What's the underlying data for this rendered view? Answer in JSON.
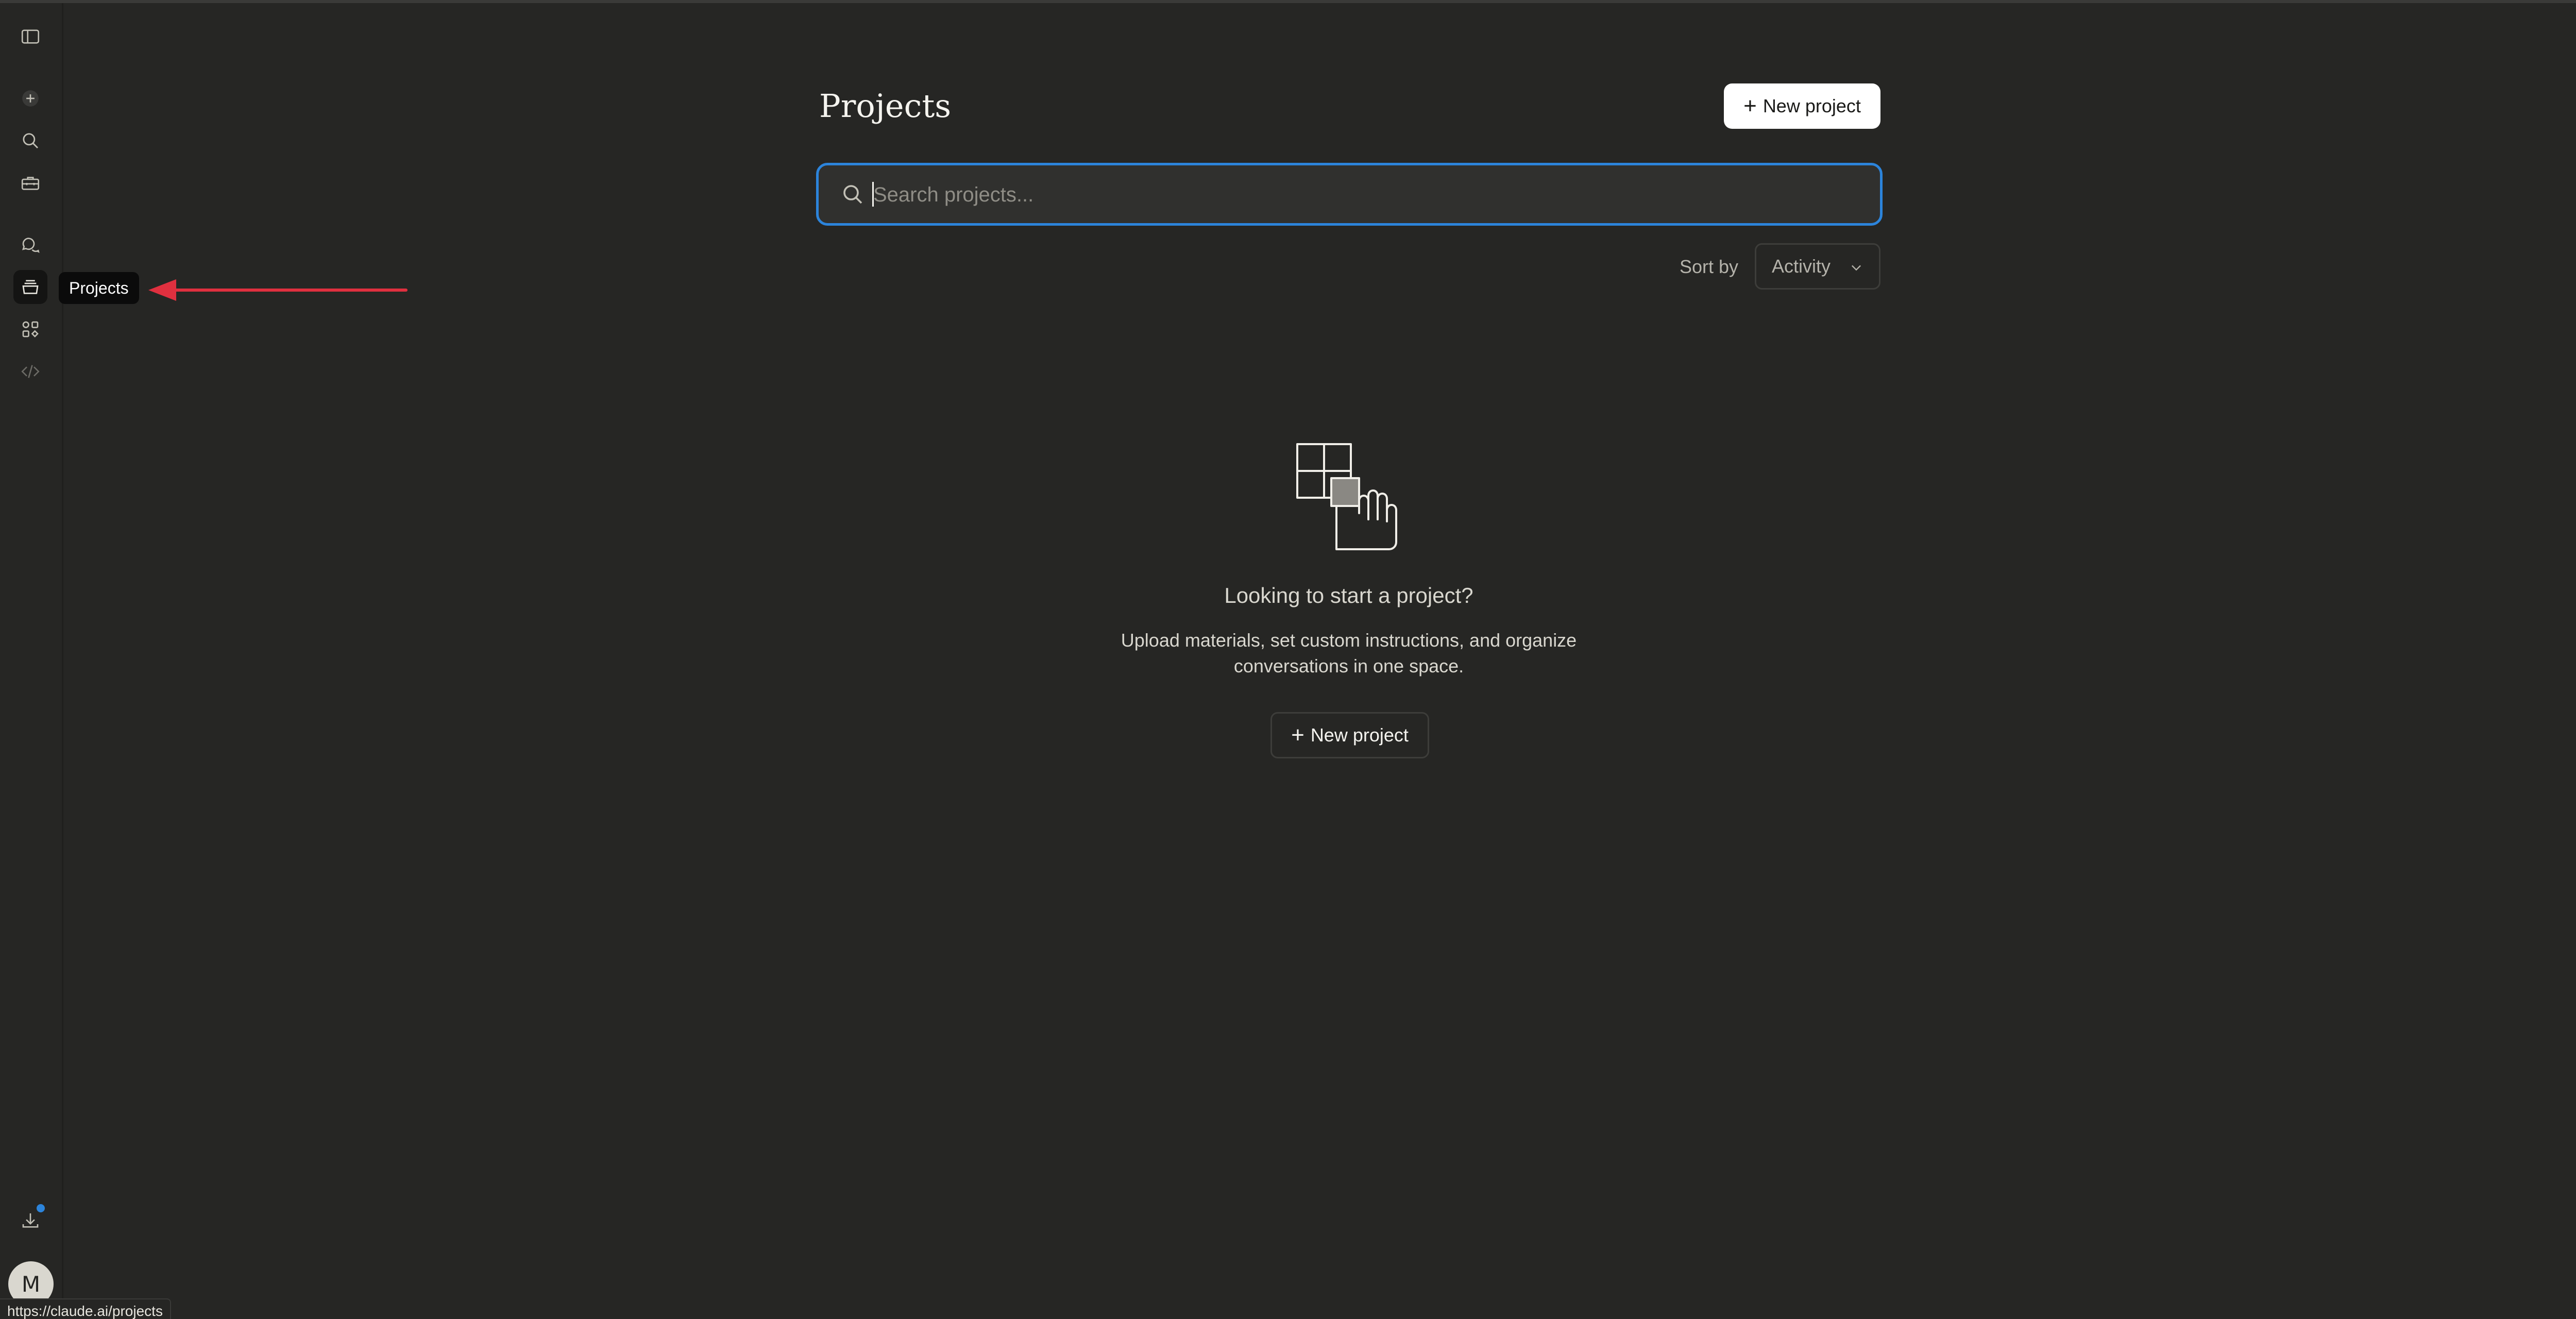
{
  "tooltip": {
    "text": "Projects"
  },
  "page": {
    "title": "Projects",
    "new_project_label": "New project"
  },
  "search": {
    "placeholder": "Search projects..."
  },
  "sort": {
    "label": "Sort by",
    "selected": "Activity"
  },
  "empty_state": {
    "heading": "Looking to start a project?",
    "description_line1": "Upload materials, set custom instructions, and organize",
    "description_line2": "conversations in one space.",
    "button_label": "New project"
  },
  "user": {
    "avatar_initial": "M"
  },
  "status_bar": {
    "url": "https://claude.ai/projects"
  },
  "colors": {
    "background": "#262624",
    "focus_ring": "#2c84db",
    "annotation_arrow": "#e0303f",
    "badge": "#2c84db"
  }
}
